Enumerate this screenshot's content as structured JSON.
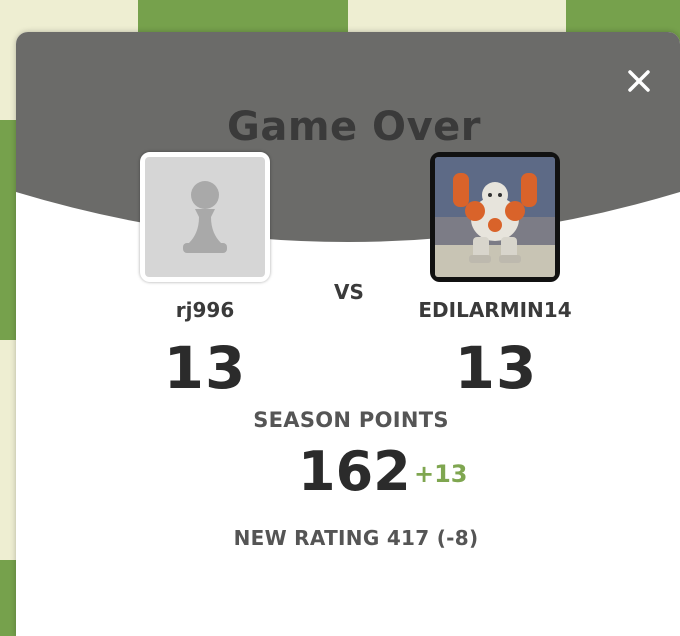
{
  "modal": {
    "title": "Game Over",
    "close_icon": "close-icon"
  },
  "players": {
    "left": {
      "name": "rj996",
      "score": "13",
      "avatar_icon": "pawn-icon"
    },
    "right": {
      "name": "EDILARMIN14",
      "score": "13",
      "avatar_icon": "robot-character-icon"
    }
  },
  "vs_label": "VS",
  "season": {
    "label": "SEASON POINTS",
    "value": "162",
    "delta": "+13"
  },
  "rating_text": "NEW RATING 417 (-8)",
  "colors": {
    "header": "#6b6b69",
    "accent_green": "#7fa650",
    "board_green": "#76a14c",
    "board_light": "#eeeed2"
  }
}
